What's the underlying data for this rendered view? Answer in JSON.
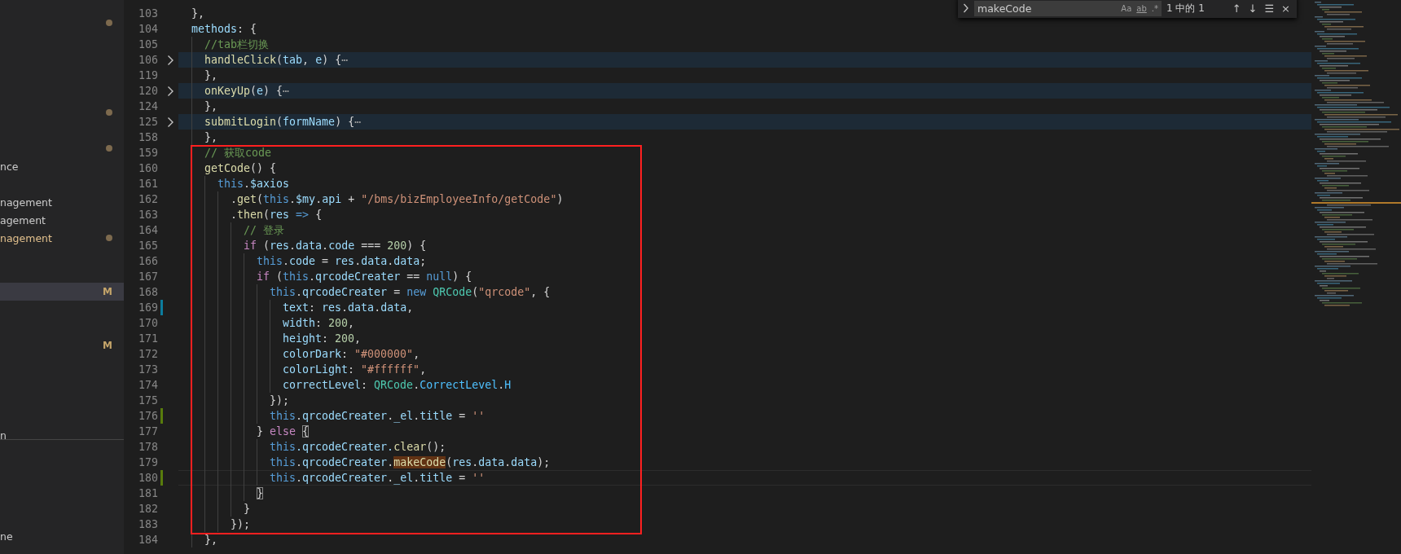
{
  "sidebar": {
    "items": [
      {
        "dot": true,
        "selected": false,
        "modified": false
      },
      {
        "dot": true,
        "selected": false,
        "modified": false
      },
      {
        "dot": true,
        "selected": false,
        "modified": false
      },
      {
        "text": "nce",
        "dot": false,
        "selected": false,
        "modified": false
      },
      {
        "text": "nagement",
        "dot": false,
        "selected": false,
        "modified": false
      },
      {
        "text": "agement",
        "dot": false,
        "selected": false,
        "modified": false
      },
      {
        "text": "nagement",
        "dot": true,
        "selected": false,
        "modified": true
      },
      {
        "badge": "M",
        "dot": false,
        "selected": true,
        "modified": false
      },
      {
        "badge": "M",
        "dot": false,
        "selected": false,
        "modified": false
      },
      {
        "text": "n",
        "dot": false,
        "selected": false,
        "modified": false
      }
    ],
    "panel_items": [
      {
        "text": "ne"
      }
    ]
  },
  "find_widget": {
    "value": "makeCode",
    "options": [
      "Aa",
      "ab",
      ".*"
    ],
    "result": "1 中的 1",
    "buttons": [
      "↑",
      "↓",
      "☰",
      "×"
    ]
  },
  "editor": {
    "lines": [
      {
        "number": "103",
        "tokens": [
          {
            "kind": "p",
            "text": "},"
          }
        ]
      },
      {
        "number": "104",
        "tokens": [
          {
            "kind": "v",
            "text": "methods"
          },
          {
            "kind": "p",
            "text": ": {"
          }
        ],
        "children": [
          {
            "number": "105",
            "tokens": [
              {
                "kind": "c",
                "text": "//tab栏切换"
              }
            ]
          },
          {
            "number": "106",
            "folded": true,
            "tokens": [
              {
                "kind": "f",
                "text": "handleClick"
              },
              {
                "kind": "p",
                "text": "("
              },
              {
                "kind": "v",
                "text": "tab"
              },
              {
                "kind": "p",
                "text": ", "
              },
              {
                "kind": "v",
                "text": "e"
              },
              {
                "kind": "p",
                "text": ") {"
              },
              {
                "kind": "e",
                "text": "⋯"
              }
            ]
          },
          {
            "number": "119",
            "tokens": [
              {
                "kind": "p",
                "text": "},"
              }
            ]
          },
          {
            "number": "120",
            "folded": true,
            "tokens": [
              {
                "kind": "f",
                "text": "onKeyUp"
              },
              {
                "kind": "p",
                "text": "("
              },
              {
                "kind": "v",
                "text": "e"
              },
              {
                "kind": "p",
                "text": ") {"
              },
              {
                "kind": "e",
                "text": "⋯"
              }
            ]
          },
          {
            "number": "124",
            "tokens": [
              {
                "kind": "p",
                "text": "},"
              }
            ]
          },
          {
            "number": "125",
            "folded": true,
            "tokens": [
              {
                "kind": "f",
                "text": "submitLogin"
              },
              {
                "kind": "p",
                "text": "("
              },
              {
                "kind": "v",
                "text": "formName"
              },
              {
                "kind": "p",
                "text": ") {"
              },
              {
                "kind": "e",
                "text": "⋯"
              }
            ]
          },
          {
            "number": "158",
            "tokens": [
              {
                "kind": "p",
                "text": "},"
              }
            ]
          },
          {
            "number": "159",
            "tokens": [
              {
                "kind": "c",
                "text": "// 获取code"
              }
            ]
          },
          {
            "number": "160",
            "tokens": [
              {
                "kind": "f",
                "text": "getCode"
              },
              {
                "kind": "p",
                "text": "() {"
              }
            ],
            "children": [
              {
                "number": "161",
                "tokens": [
                  {
                    "kind": "k",
                    "text": "this"
                  },
                  {
                    "kind": "p",
                    "text": "."
                  },
                  {
                    "kind": "v",
                    "text": "$axios"
                  }
                ],
                "children": [
                  {
                    "number": "162",
                    "tokens": [
                      {
                        "kind": "p",
                        "text": "."
                      },
                      {
                        "kind": "f",
                        "text": "get"
                      },
                      {
                        "kind": "p",
                        "text": "("
                      },
                      {
                        "kind": "k",
                        "text": "this"
                      },
                      {
                        "kind": "p",
                        "text": "."
                      },
                      {
                        "kind": "v",
                        "text": "$my"
                      },
                      {
                        "kind": "p",
                        "text": "."
                      },
                      {
                        "kind": "v",
                        "text": "api"
                      },
                      {
                        "kind": "p",
                        "text": " + "
                      },
                      {
                        "kind": "s",
                        "text": "\"/bms/bizEmployeeInfo/getCode\""
                      },
                      {
                        "kind": "p",
                        "text": ")"
                      }
                    ]
                  },
                  {
                    "number": "163",
                    "tokens": [
                      {
                        "kind": "p",
                        "text": "."
                      },
                      {
                        "kind": "f",
                        "text": "then"
                      },
                      {
                        "kind": "p",
                        "text": "("
                      },
                      {
                        "kind": "v",
                        "text": "res"
                      },
                      {
                        "kind": "k",
                        "text": " =>"
                      },
                      {
                        "kind": "p",
                        "text": " {"
                      }
                    ],
                    "children": [
                      {
                        "number": "164",
                        "tokens": [
                          {
                            "kind": "c",
                            "text": "// 登录"
                          }
                        ]
                      },
                      {
                        "number": "165",
                        "tokens": [
                          {
                            "kind": "x",
                            "text": "if"
                          },
                          {
                            "kind": "p",
                            "text": " ("
                          },
                          {
                            "kind": "v",
                            "text": "res"
                          },
                          {
                            "kind": "p",
                            "text": "."
                          },
                          {
                            "kind": "v",
                            "text": "data"
                          },
                          {
                            "kind": "p",
                            "text": "."
                          },
                          {
                            "kind": "v",
                            "text": "code"
                          },
                          {
                            "kind": "p",
                            "text": " === "
                          },
                          {
                            "kind": "n",
                            "text": "200"
                          },
                          {
                            "kind": "p",
                            "text": ") {"
                          }
                        ],
                        "children": [
                          {
                            "number": "166",
                            "tokens": [
                              {
                                "kind": "k",
                                "text": "this"
                              },
                              {
                                "kind": "p",
                                "text": "."
                              },
                              {
                                "kind": "v",
                                "text": "code"
                              },
                              {
                                "kind": "p",
                                "text": " = "
                              },
                              {
                                "kind": "v",
                                "text": "res"
                              },
                              {
                                "kind": "p",
                                "text": "."
                              },
                              {
                                "kind": "v",
                                "text": "data"
                              },
                              {
                                "kind": "p",
                                "text": "."
                              },
                              {
                                "kind": "v",
                                "text": "data"
                              },
                              {
                                "kind": "p",
                                "text": ";"
                              }
                            ]
                          },
                          {
                            "number": "167",
                            "tokens": [
                              {
                                "kind": "x",
                                "text": "if"
                              },
                              {
                                "kind": "p",
                                "text": " ("
                              },
                              {
                                "kind": "k",
                                "text": "this"
                              },
                              {
                                "kind": "p",
                                "text": "."
                              },
                              {
                                "kind": "v",
                                "text": "qrcodeCreater"
                              },
                              {
                                "kind": "p",
                                "text": " == "
                              },
                              {
                                "kind": "k",
                                "text": "null"
                              },
                              {
                                "kind": "p",
                                "text": ") {"
                              }
                            ],
                            "children": [
                              {
                                "number": "168",
                                "tokens": [
                                  {
                                    "kind": "k",
                                    "text": "this"
                                  },
                                  {
                                    "kind": "p",
                                    "text": "."
                                  },
                                  {
                                    "kind": "v",
                                    "text": "qrcodeCreater"
                                  },
                                  {
                                    "kind": "p",
                                    "text": " = "
                                  },
                                  {
                                    "kind": "k",
                                    "text": "new "
                                  },
                                  {
                                    "kind": "t",
                                    "text": "QRCode"
                                  },
                                  {
                                    "kind": "p",
                                    "text": "("
                                  },
                                  {
                                    "kind": "s",
                                    "text": "\"qrcode\""
                                  },
                                  {
                                    "kind": "p",
                                    "text": ", {"
                                  }
                                ],
                                "children": [
                                  {
                                    "number": "169",
                                    "modified": true,
                                    "tokens": [
                                      {
                                        "kind": "v",
                                        "text": "text"
                                      },
                                      {
                                        "kind": "p",
                                        "text": ": "
                                      },
                                      {
                                        "kind": "v",
                                        "text": "res"
                                      },
                                      {
                                        "kind": "p",
                                        "text": "."
                                      },
                                      {
                                        "kind": "v",
                                        "text": "data"
                                      },
                                      {
                                        "kind": "p",
                                        "text": "."
                                      },
                                      {
                                        "kind": "v",
                                        "text": "data"
                                      },
                                      {
                                        "kind": "p",
                                        "text": ","
                                      }
                                    ]
                                  },
                                  {
                                    "number": "170",
                                    "tokens": [
                                      {
                                        "kind": "v",
                                        "text": "width"
                                      },
                                      {
                                        "kind": "p",
                                        "text": ": "
                                      },
                                      {
                                        "kind": "n",
                                        "text": "200"
                                      },
                                      {
                                        "kind": "p",
                                        "text": ","
                                      }
                                    ]
                                  },
                                  {
                                    "number": "171",
                                    "tokens": [
                                      {
                                        "kind": "v",
                                        "text": "height"
                                      },
                                      {
                                        "kind": "p",
                                        "text": ": "
                                      },
                                      {
                                        "kind": "n",
                                        "text": "200"
                                      },
                                      {
                                        "kind": "p",
                                        "text": ","
                                      }
                                    ]
                                  },
                                  {
                                    "number": "172",
                                    "tokens": [
                                      {
                                        "kind": "v",
                                        "text": "colorDark"
                                      },
                                      {
                                        "kind": "p",
                                        "text": ": "
                                      },
                                      {
                                        "kind": "s",
                                        "text": "\"#000000\""
                                      },
                                      {
                                        "kind": "p",
                                        "text": ","
                                      }
                                    ]
                                  },
                                  {
                                    "number": "173",
                                    "tokens": [
                                      {
                                        "kind": "v",
                                        "text": "colorLight"
                                      },
                                      {
                                        "kind": "p",
                                        "text": ": "
                                      },
                                      {
                                        "kind": "s",
                                        "text": "\"#ffffff\""
                                      },
                                      {
                                        "kind": "p",
                                        "text": ","
                                      }
                                    ]
                                  },
                                  {
                                    "number": "174",
                                    "tokens": [
                                      {
                                        "kind": "v",
                                        "text": "correctLevel"
                                      },
                                      {
                                        "kind": "p",
                                        "text": ": "
                                      },
                                      {
                                        "kind": "t",
                                        "text": "QRCode"
                                      },
                                      {
                                        "kind": "p",
                                        "text": "."
                                      },
                                      {
                                        "kind": "o",
                                        "text": "CorrectLevel"
                                      },
                                      {
                                        "kind": "p",
                                        "text": "."
                                      },
                                      {
                                        "kind": "o",
                                        "text": "H"
                                      }
                                    ]
                                  }
                                ]
                              },
                              {
                                "number": "175",
                                "tokens": [
                                  {
                                    "kind": "p",
                                    "text": "});"
                                  }
                                ]
                              },
                              {
                                "number": "176",
                                "added": true,
                                "tokens": [
                                  {
                                    "kind": "k",
                                    "text": "this"
                                  },
                                  {
                                    "kind": "p",
                                    "text": "."
                                  },
                                  {
                                    "kind": "v",
                                    "text": "qrcodeCreater"
                                  },
                                  {
                                    "kind": "p",
                                    "text": "."
                                  },
                                  {
                                    "kind": "v",
                                    "text": "_el"
                                  },
                                  {
                                    "kind": "p",
                                    "text": "."
                                  },
                                  {
                                    "kind": "v",
                                    "text": "title"
                                  },
                                  {
                                    "kind": "p",
                                    "text": " = "
                                  },
                                  {
                                    "kind": "s",
                                    "text": "''"
                                  }
                                ]
                              }
                            ]
                          },
                          {
                            "number": "177",
                            "tokens": [
                              {
                                "kind": "p",
                                "text": "} "
                              },
                              {
                                "kind": "x",
                                "text": "else "
                              },
                              {
                                "kind": "b",
                                "text": "{"
                              }
                            ],
                            "children": [
                              {
                                "number": "178",
                                "tokens": [
                                  {
                                    "kind": "k",
                                    "text": "this"
                                  },
                                  {
                                    "kind": "v",
                                    "text": ".qrcodeCreater."
                                  },
                                  {
                                    "kind": "f",
                                    "text": "clear"
                                  },
                                  {
                                    "kind": "p",
                                    "text": "();"
                                  }
                                ]
                              },
                              {
                                "number": "179",
                                "tokens": [
                                  {
                                    "kind": "k",
                                    "text": "this"
                                  },
                                  {
                                    "kind": "p",
                                    "text": "."
                                  },
                                  {
                                    "kind": "v",
                                    "text": "qrcodeCreater"
                                  },
                                  {
                                    "kind": "p",
                                    "text": "."
                                  },
                                  {
                                    "kind": "m",
                                    "text": "makeCode"
                                  },
                                  {
                                    "kind": "p",
                                    "text": "("
                                  },
                                  {
                                    "kind": "v",
                                    "text": "res"
                                  },
                                  {
                                    "kind": "p",
                                    "text": "."
                                  },
                                  {
                                    "kind": "v",
                                    "text": "data"
                                  },
                                  {
                                    "kind": "p",
                                    "text": "."
                                  },
                                  {
                                    "kind": "v",
                                    "text": "data"
                                  },
                                  {
                                    "kind": "p",
                                    "text": ");"
                                  }
                                ]
                              },
                              {
                                "number": "180",
                                "added": true,
                                "current": true,
                                "tokens": [
                                  {
                                    "kind": "k",
                                    "text": "this"
                                  },
                                  {
                                    "kind": "p",
                                    "text": "."
                                  },
                                  {
                                    "kind": "v",
                                    "text": "qrcodeCreater"
                                  },
                                  {
                                    "kind": "p",
                                    "text": "."
                                  },
                                  {
                                    "kind": "v",
                                    "text": "_el"
                                  },
                                  {
                                    "kind": "p",
                                    "text": "."
                                  },
                                  {
                                    "kind": "v",
                                    "text": "title"
                                  },
                                  {
                                    "kind": "p",
                                    "text": " = "
                                  },
                                  {
                                    "kind": "s",
                                    "text": "''"
                                  }
                                ]
                              }
                            ]
                          },
                          {
                            "number": "181",
                            "tokens": [
                              {
                                "kind": "b",
                                "text": "}"
                              }
                            ]
                          }
                        ]
                      },
                      {
                        "number": "182",
                        "tokens": [
                          {
                            "kind": "p",
                            "text": "}"
                          }
                        ]
                      }
                    ]
                  },
                  {
                    "number": "183",
                    "tokens": [
                      {
                        "kind": "p",
                        "text": "});"
                      }
                    ]
                  }
                ]
              }
            ]
          },
          {
            "number": "184",
            "tokens": [
              {
                "kind": "p",
                "text": "},"
              }
            ]
          }
        ]
      }
    ]
  }
}
